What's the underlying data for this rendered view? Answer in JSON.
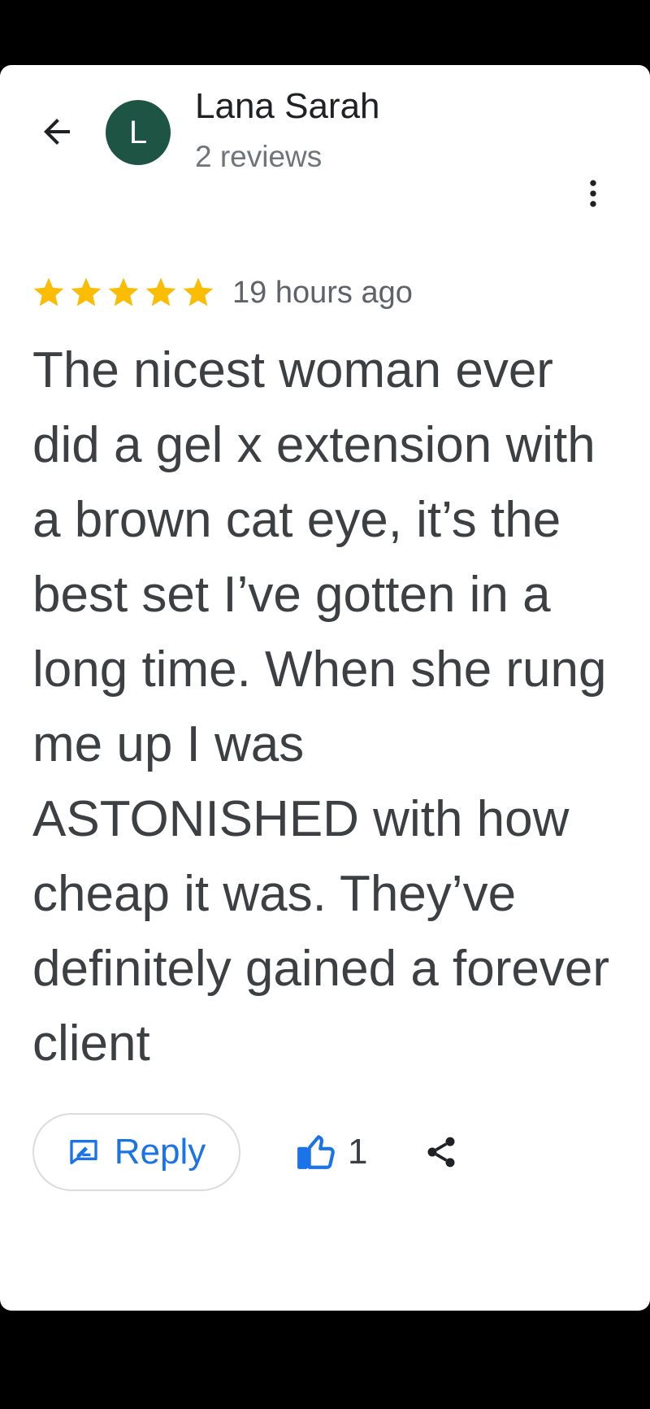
{
  "review": {
    "reviewer_name": "Lana Sarah",
    "reviewer_initial": "L",
    "reviewer_subtitle": "2 reviews",
    "rating": 5,
    "rating_max": 5,
    "time_ago": "19 hours ago",
    "text": "The nicest woman ever did a gel x extension with a brown cat eye, it’s the best set I’ve gotten in a long time. When she rung me up I was ASTONISHED with how cheap it was. They’ve definitely gained a forever client"
  },
  "actions": {
    "reply_label": "Reply",
    "like_count": "1"
  },
  "icons": {
    "back": "arrow-back-icon",
    "more": "more-vert-icon",
    "star": "star-icon",
    "reply": "reply-icon",
    "like": "thumb-up-icon",
    "share": "share-icon"
  },
  "colors": {
    "avatar_bg": "#1e5443",
    "star": "#fbbc04",
    "accent_blue": "#1a73e8",
    "text_primary": "#202124",
    "text_secondary": "#5f6368",
    "screen_bg": "#000000",
    "sheet_bg": "#ffffff"
  }
}
